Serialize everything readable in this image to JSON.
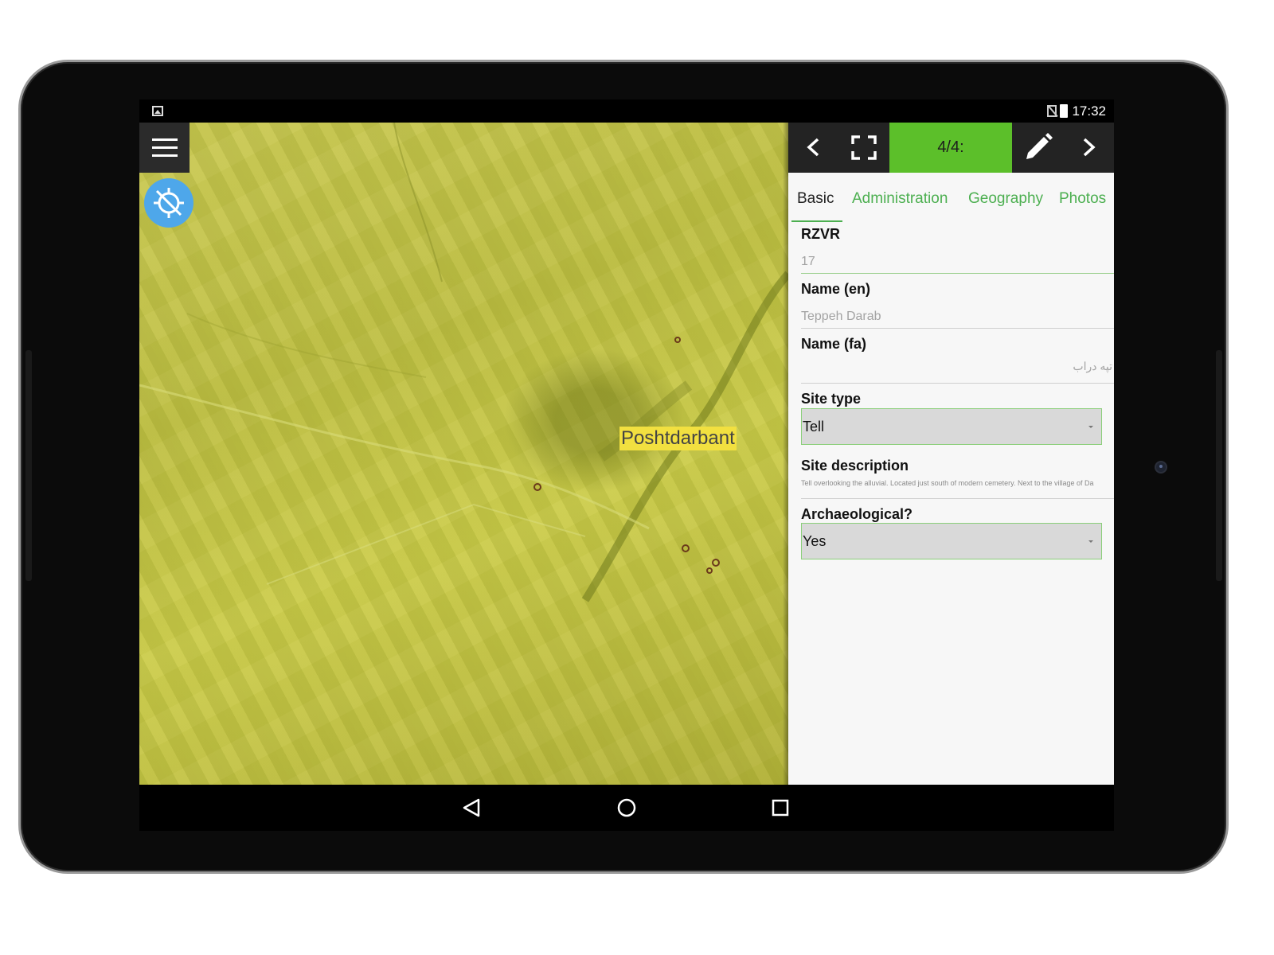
{
  "statusbar": {
    "time": "17:32",
    "icons": [
      "image-icon",
      "no-sim-icon",
      "battery-charging-icon"
    ]
  },
  "map": {
    "label": "Poshtdarbant",
    "menu_icon": "hamburger-menu-icon",
    "locate_icon": "location-disabled-icon"
  },
  "toolbar": {
    "counter": "4/4:",
    "icons": [
      "chevron-left-icon",
      "fullscreen-icon",
      "pencil-icon",
      "chevron-right-icon"
    ],
    "accent_color": "#5cbf2a"
  },
  "tabs": [
    {
      "label": "Basic",
      "active": true
    },
    {
      "label": "Administration",
      "active": false
    },
    {
      "label": "Geography",
      "active": false
    },
    {
      "label": "Photos",
      "active": false
    }
  ],
  "fields": {
    "rzvr": {
      "label": "RZVR",
      "value": "17"
    },
    "name_en": {
      "label": "Name (en)",
      "value": "Teppeh Darab"
    },
    "name_fa": {
      "label": "Name (fa)",
      "value": "تپه دراب"
    },
    "site_type": {
      "label": "Site type",
      "value": "Tell"
    },
    "site_description": {
      "label": "Site description",
      "value": "Tell overlooking the alluvial. Located just south of modern cemetery. Next to the village of Da"
    },
    "archaeological": {
      "label": "Archaeological?",
      "value": "Yes"
    }
  },
  "navbar": {
    "icons": [
      "back-triangle-icon",
      "home-circle-icon",
      "recents-square-icon"
    ]
  }
}
